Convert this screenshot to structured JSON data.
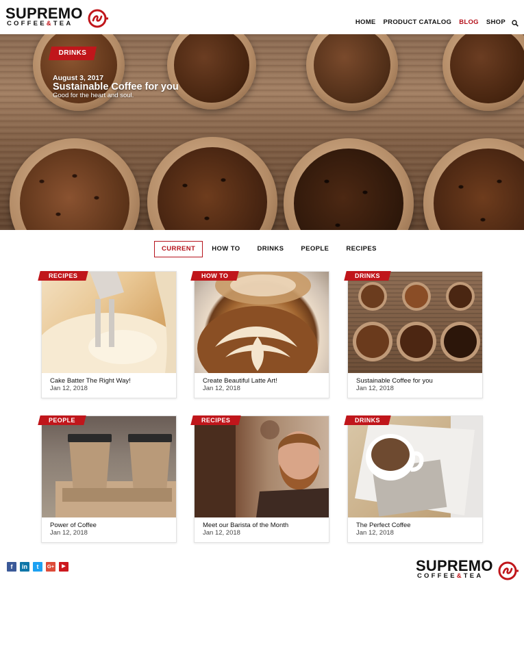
{
  "brand": {
    "name": "SUPREMO",
    "tagline_left": "COFFEE",
    "tagline_amp": "&",
    "tagline_right": "TEA",
    "accent": "#c0161b"
  },
  "nav": {
    "items": [
      {
        "label": "HOME"
      },
      {
        "label": "PRODUCT CATALOG"
      },
      {
        "label": "BLOG",
        "active": true
      },
      {
        "label": "SHOP"
      }
    ],
    "search_icon": "search-icon"
  },
  "hero": {
    "category": "DRINKS",
    "date": "August 3, 2017",
    "title": "Sustainable Coffee for you",
    "subtitle": "Good for the heart and soul."
  },
  "filters": {
    "tabs": [
      {
        "label": "CURRENT",
        "selected": true
      },
      {
        "label": "HOW TO"
      },
      {
        "label": "DRINKS"
      },
      {
        "label": "PEOPLE"
      },
      {
        "label": "RECIPES"
      }
    ]
  },
  "posts": [
    {
      "category": "RECIPES",
      "title": "Cake Batter The Right Way!",
      "date": "Jan 12, 2018"
    },
    {
      "category": "HOW TO",
      "title": "Create Beautiful Latte Art!",
      "date": "Jan 12, 2018"
    },
    {
      "category": "DRINKS",
      "title": "Sustainable Coffee for you",
      "date": "Jan 12, 2018"
    },
    {
      "category": "PEOPLE",
      "title": "Power of Coffee",
      "date": "Jan 12, 2018"
    },
    {
      "category": "RECIPES",
      "title": "Meet our Barista of the Month",
      "date": "Jan 12, 2018"
    },
    {
      "category": "DRINKS",
      "title": "The Perfect Coffee",
      "date": "Jan 12, 2018"
    }
  ],
  "footer": {
    "social": [
      {
        "icon": "facebook-icon",
        "glyph": "f",
        "color": "#3b5998"
      },
      {
        "icon": "linkedin-icon",
        "glyph": "in",
        "color": "#0e76a8"
      },
      {
        "icon": "twitter-icon",
        "glyph": "t",
        "color": "#1da1f2"
      },
      {
        "icon": "google-plus-icon",
        "glyph": "G+",
        "color": "#dd4b39"
      },
      {
        "icon": "youtube-icon",
        "glyph": "▶",
        "color": "#cc181e"
      }
    ]
  }
}
